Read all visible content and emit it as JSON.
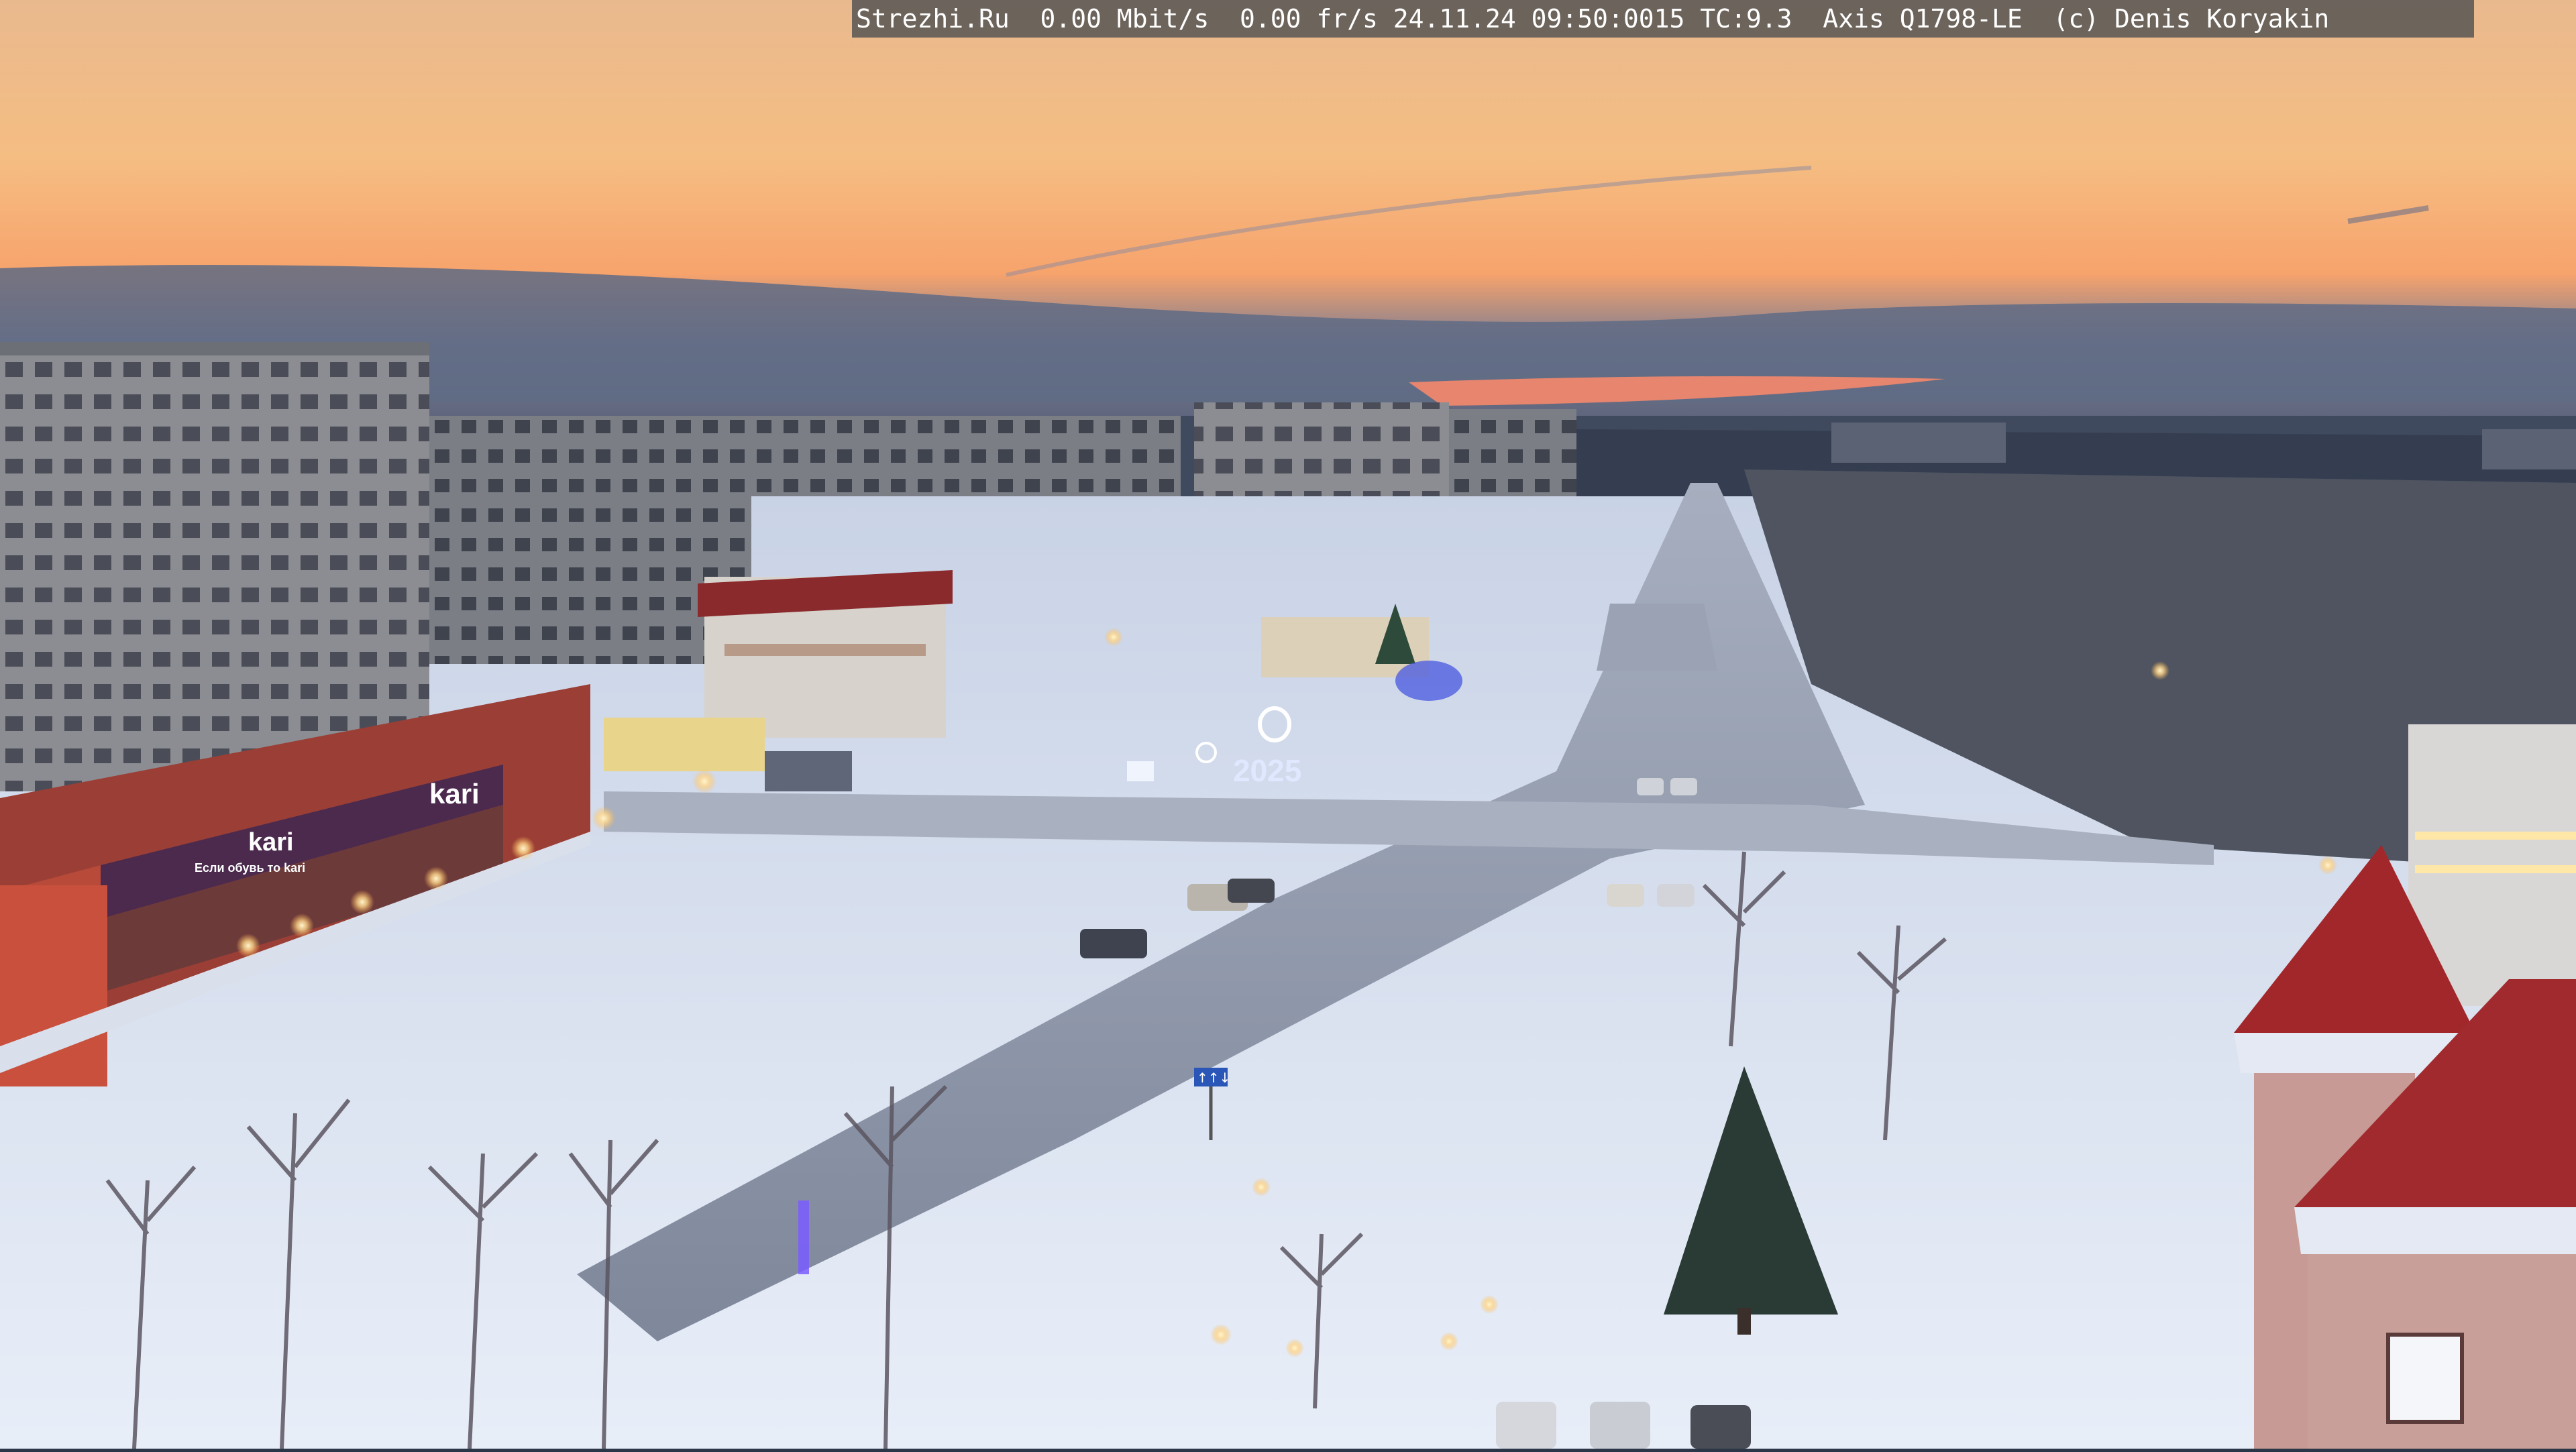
{
  "overlay": {
    "text": "Strezhi.Ru  0.00 Mbit/s  0.00 fr/s 24.11.24 09:50:0015 TC:9.3  Axis Q1798-LE  (c) Denis Koryakin"
  },
  "signs": {
    "store_brand": "kari",
    "store_brand_2": "kari",
    "store_slogan": "Если обувь то kari",
    "new_year": "2025",
    "road_sign": "↑↑↓"
  },
  "palette": {
    "sky_top": "#f2c08a",
    "sky_glow": "#f7a86a",
    "cloud_band": "#56637c",
    "snow": "#dfe6f2",
    "road": "#8d96a8",
    "building_brick": "#9a3d35",
    "panel_building": "#8f8f93",
    "roof_red": "#a02a2c"
  }
}
